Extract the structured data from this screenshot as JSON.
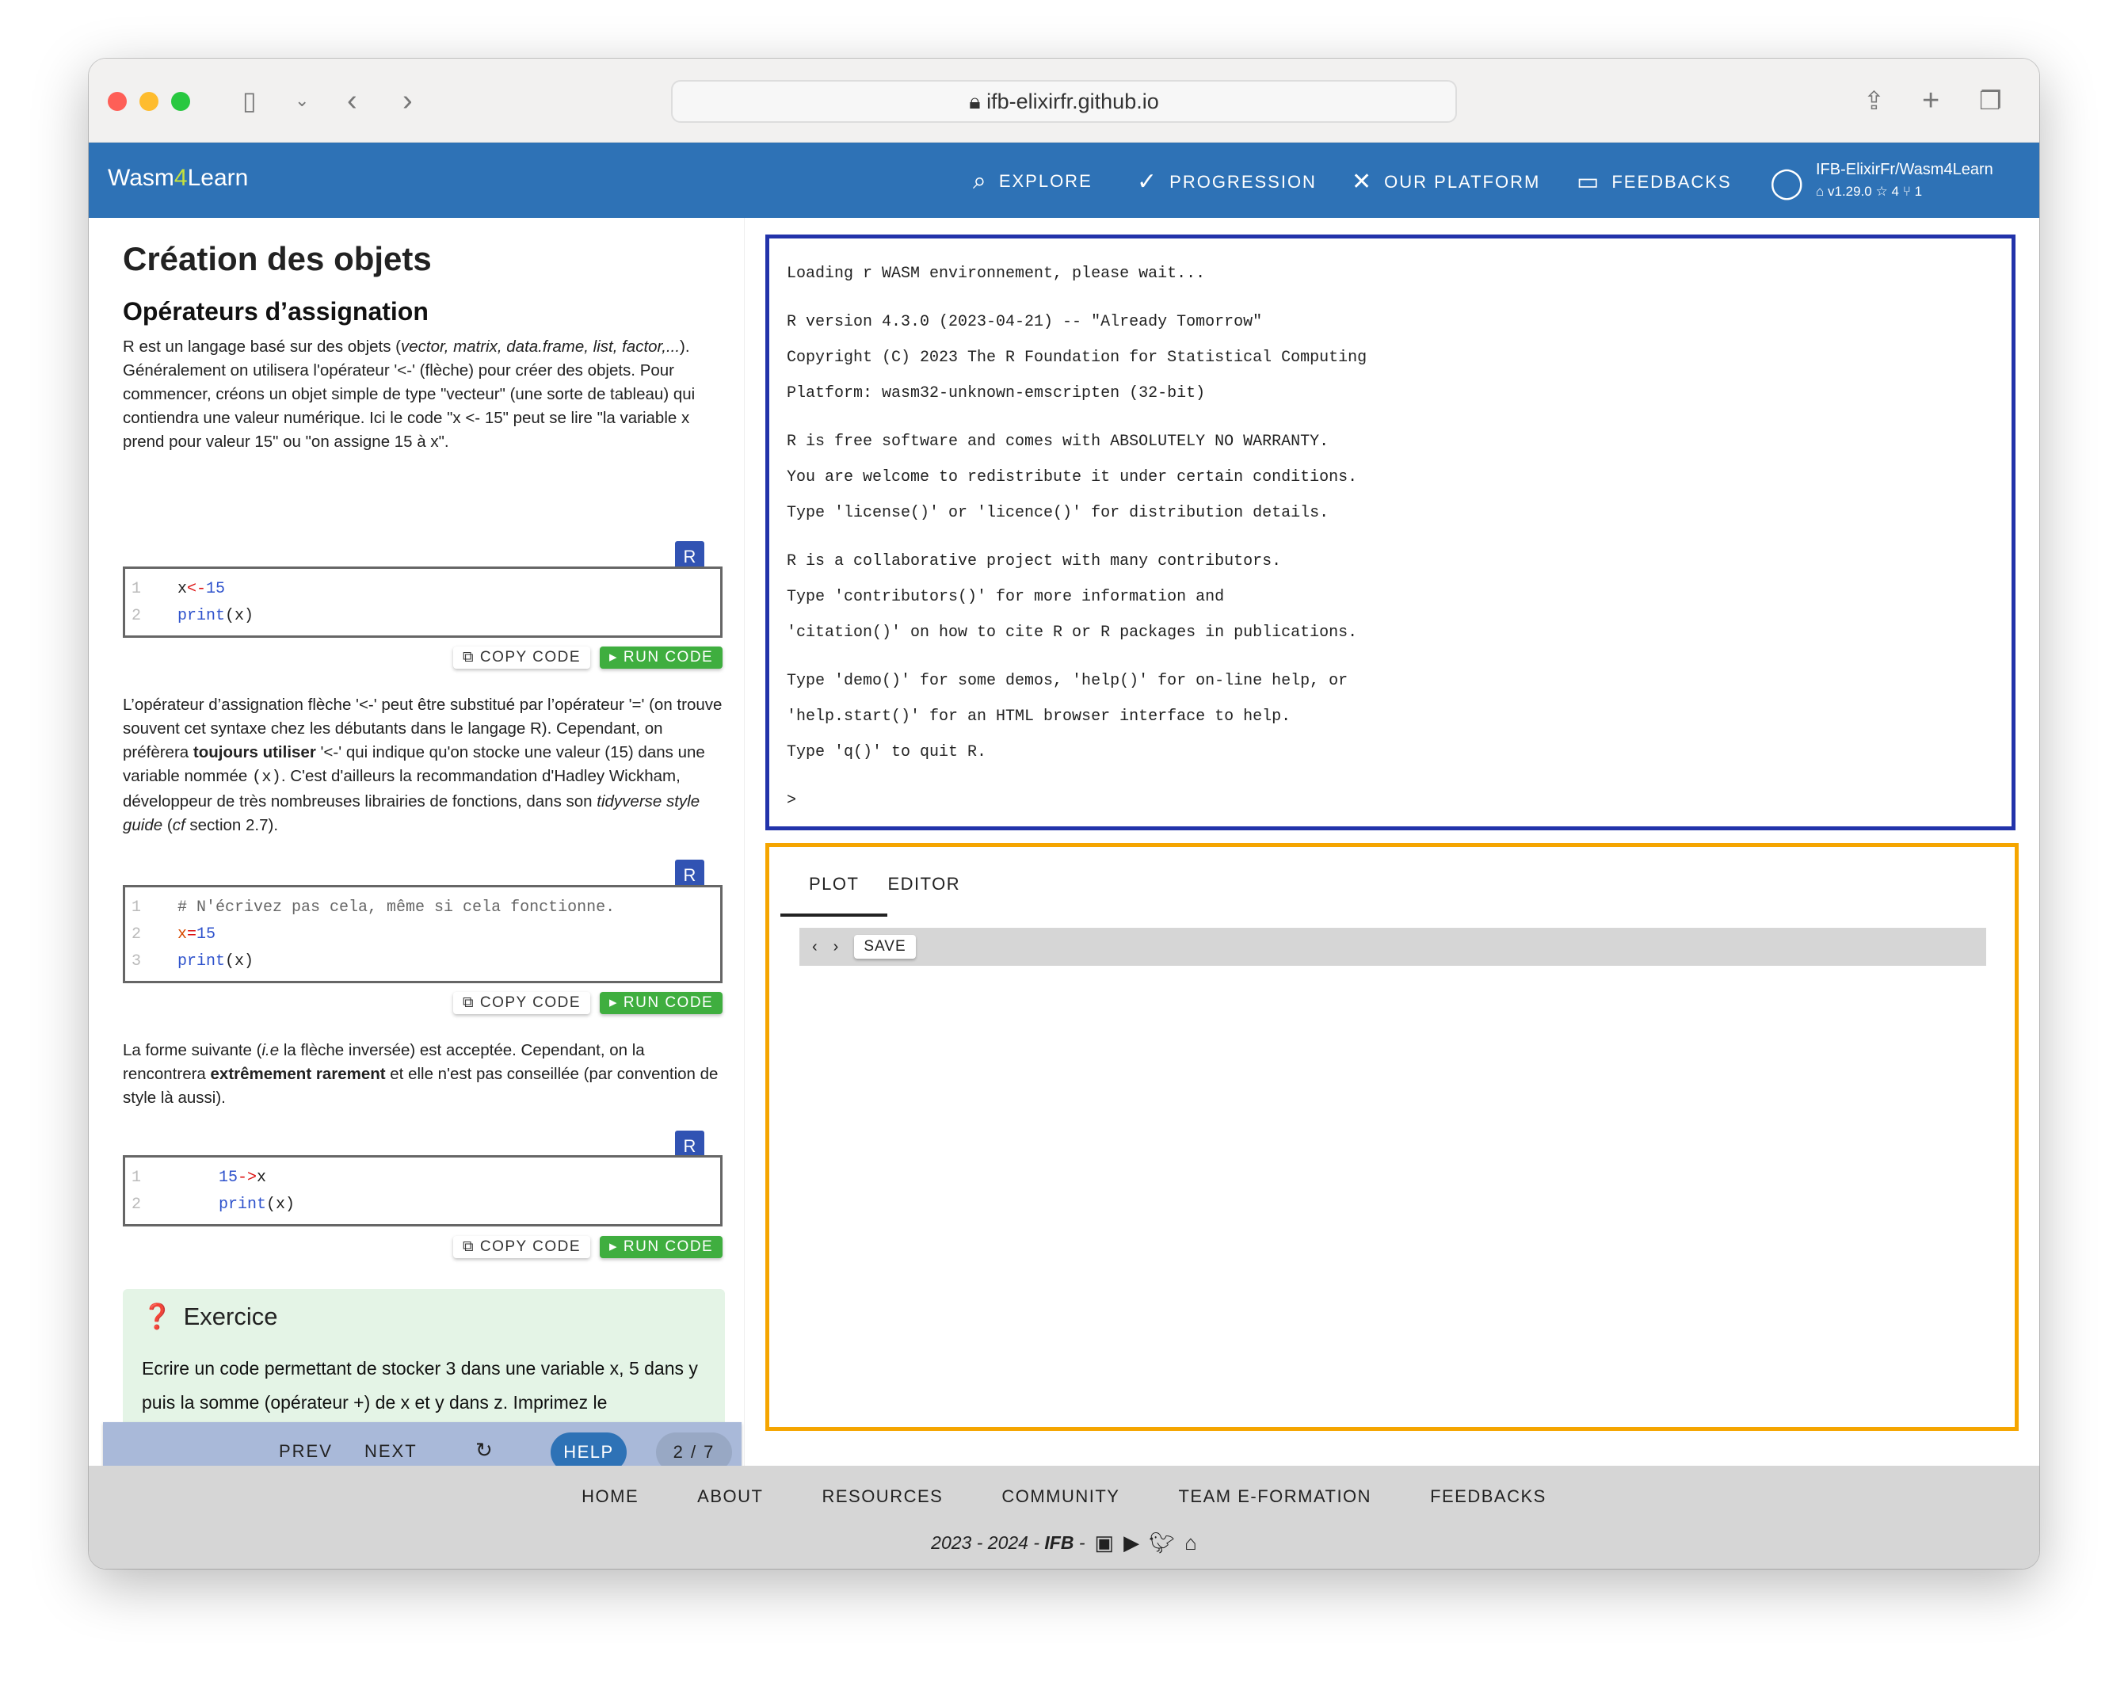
{
  "browser": {
    "url": "ifb-elixirfr.github.io"
  },
  "header": {
    "brand_pre": "Wasm",
    "brand_mid": "4",
    "brand_post": "Learn",
    "nav": [
      {
        "label": "EXPLORE",
        "icon": "search-icon"
      },
      {
        "label": "PROGRESSION",
        "icon": "check-circle-icon"
      },
      {
        "label": "OUR PLATFORM",
        "icon": "tools-icon"
      },
      {
        "label": "FEEDBACKS",
        "icon": "chat-icon"
      }
    ],
    "repo": "IFB-ElixirFr/Wasm4Learn",
    "version": "v1.29.0",
    "stars": "4",
    "forks": "1"
  },
  "lesson": {
    "title": "Création des objets",
    "subtitle": "Opérateurs d’assignation",
    "p1": {
      "a": "R est un langage basé sur des objets (",
      "i": "vector, matrix, data.frame, list, factor,...",
      "b": "). Généralement on utilisera l'opérateur '<-' (flèche) pour créer des objets. Pour commencer, créons un objet simple de type \"vecteur\" (une sorte de tableau) qui contiendra une valeur numérique. Ici le code \"x <- 15\" peut se lire \"la variable x prend pour valeur 15\" ou \"on assigne 15 à x\"."
    },
    "p2": {
      "a": "L’opérateur d’assignation flèche '<-' peut être substitué par l’opérateur '=' (on trouve souvent cet syntaxe chez les débutants dans le langage R). Cependant, on préfèrera ",
      "b": "toujours utiliser",
      "c": " '<-' qui indique qu'on stocke une valeur (15) dans une variable nommée ",
      "code": "(x)",
      "d": ". C'est d'ailleurs la recommandation d'Hadley Wickham, développeur de très nombreuses librairies de fonctions, dans son ",
      "i": "tidyverse style guide",
      "e": " (",
      "cf": "cf",
      "f": " section 2.7)."
    },
    "p3": {
      "a": "La forme suivante (",
      "i": "i.e",
      "b": " la flèche inversée) est acceptée. Cependant, on la rencontrera ",
      "bold": "extrêmement rarement",
      "c": " et elle n'est pas conseillée (par convention de style là aussi)."
    },
    "lang_badge": "R",
    "copy_label": "COPY CODE",
    "run_label": "RUN CODE",
    "code1": {
      "l1": [
        "x",
        " <- ",
        "15"
      ],
      "l2": [
        "print",
        "(x)"
      ]
    },
    "code2": {
      "l1": "# N'écrivez pas cela, même si cela fonctionne.",
      "l2": [
        "x",
        " = ",
        "15"
      ],
      "l3": [
        "print",
        "(x)"
      ]
    },
    "code3": {
      "l1": [
        "15",
        " -> ",
        "x"
      ],
      "l2": [
        "print",
        "(x)"
      ]
    },
    "line_numbers": [
      "1",
      "2",
      "3"
    ],
    "exercise": {
      "title": "Exercice",
      "text": "Ecrire un code permettant de stocker 3 dans une variable x, 5 dans y puis la somme (opérateur +) de x et y dans z. Imprimez le"
    },
    "nav": {
      "prev": "PREV",
      "next": "NEXT",
      "help": "HELP",
      "page": "2 / 7"
    }
  },
  "console": [
    "Loading r WASM environnement, please wait...",
    "",
    "R version 4.3.0 (2023-04-21) -- \"Already Tomorrow\"",
    "Copyright (C) 2023 The R Foundation for Statistical Computing",
    "Platform: wasm32-unknown-emscripten (32-bit)",
    "",
    "R is free software and comes with ABSOLUTELY NO WARRANTY.",
    "You are welcome to redistribute it under certain conditions.",
    "Type 'license()' or 'licence()' for distribution details.",
    "",
    "R is a collaborative project with many contributors.",
    "Type 'contributors()' for more information and",
    "'citation()' on how to cite R or R packages in publications.",
    "",
    "Type 'demo()' for some demos, 'help()' for on-line help, or",
    "'help.start()' for an HTML browser interface to help.",
    "Type 'q()' to quit R.",
    "",
    ">"
  ],
  "plot_panel": {
    "tabs": [
      "PLOT",
      "EDITOR"
    ],
    "active_tab": "PLOT",
    "prev": "‹",
    "next": "›",
    "save": "SAVE"
  },
  "footer": {
    "links": [
      "HOME",
      "ABOUT",
      "RESOURCES",
      "COMMUNITY",
      "TEAM E-FORMATION",
      "FEEDBACKS"
    ],
    "years": "2023 - 2024 - ",
    "org": "IFB",
    "sep": " -"
  },
  "colors": {
    "header": "#2e72b6",
    "console_border": "#2233aa",
    "plot_border": "#f5a500",
    "run": "#3fae3f",
    "exercise_bg": "#e4f4e6"
  }
}
